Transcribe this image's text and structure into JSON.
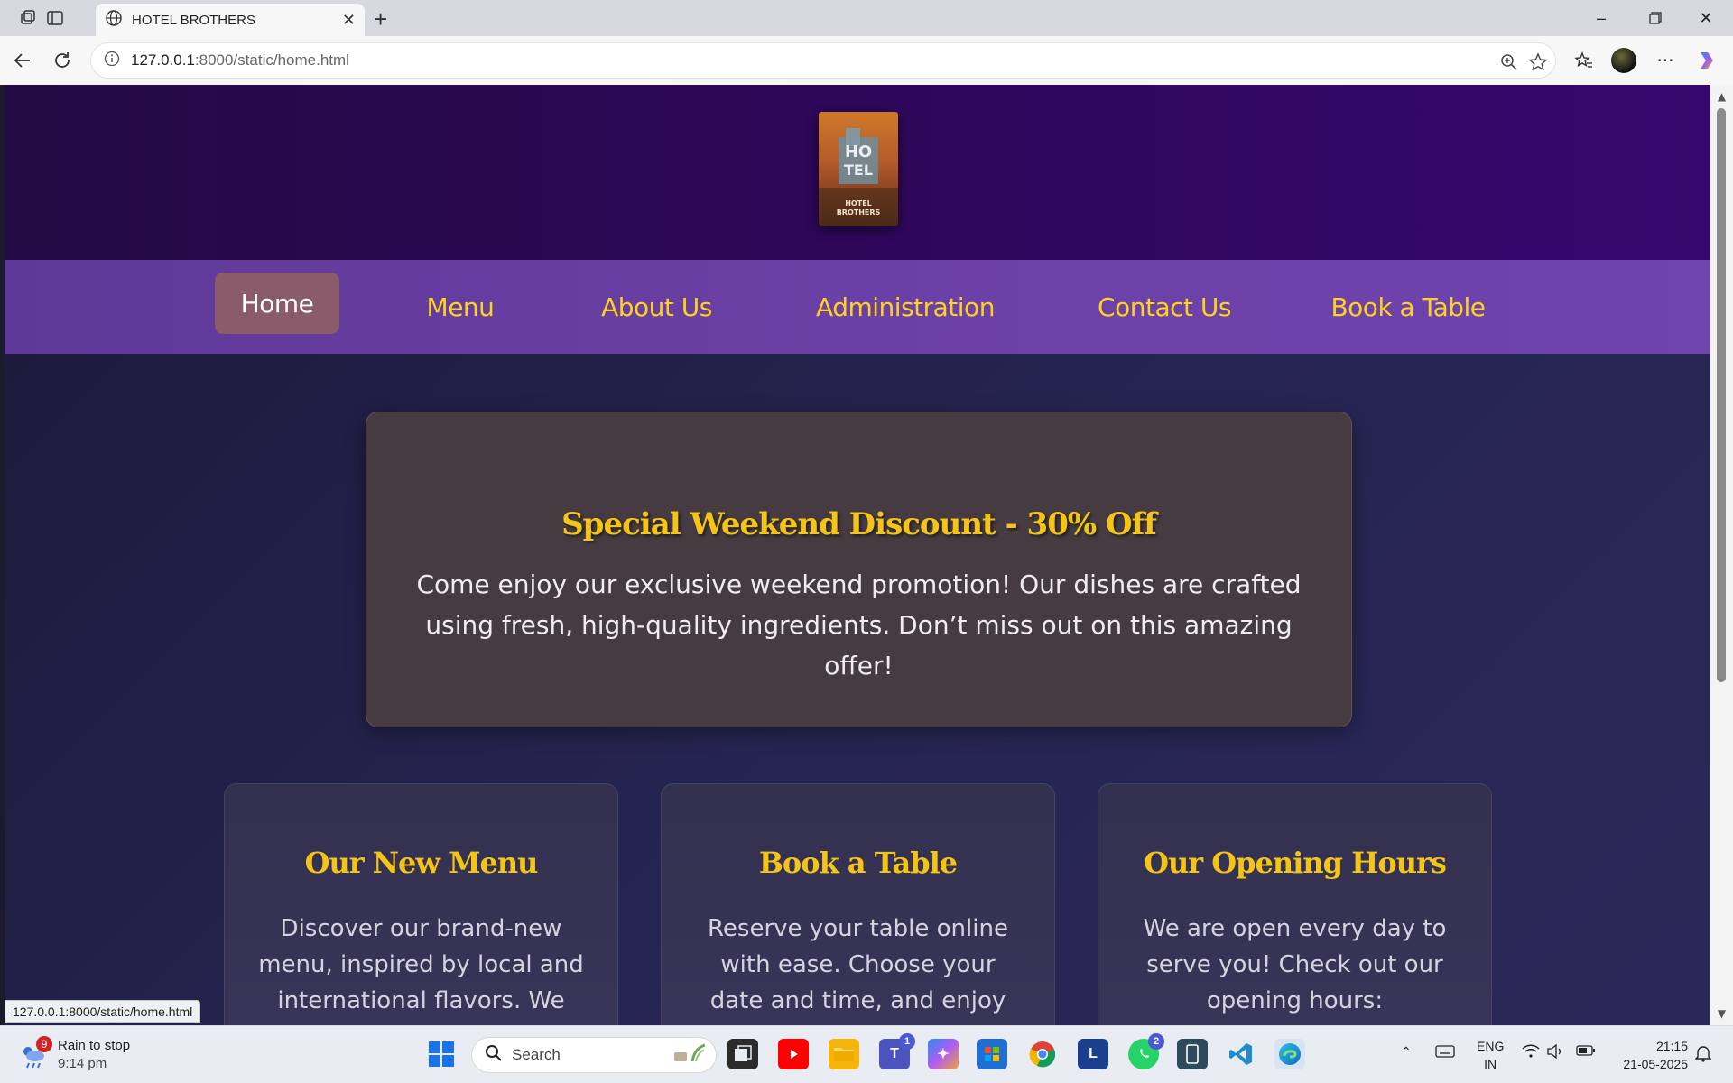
{
  "browser": {
    "tab_title": "HOTEL BROTHERS",
    "url_host": "127.0.0.1",
    "url_rest": ":8000/static/home.html",
    "status_url": "127.0.0.1:8000/static/home.html"
  },
  "site": {
    "logo_text": "HOTEL BROTHERS",
    "nav": {
      "home": "Home",
      "menu": "Menu",
      "about": "About Us",
      "admin": "Administration",
      "contact": "Contact Us",
      "book": "Book a Table"
    },
    "promo": {
      "title": "Special Weekend Discount - 30% Off",
      "text": "Come enjoy our exclusive weekend promotion! Our dishes are crafted using fresh, high-quality ingredients. Don’t miss out on this amazing offer!"
    },
    "cards": [
      {
        "title": "Our New Menu",
        "text": "Discover our brand-new menu, inspired by local and international flavors. We have"
      },
      {
        "title": "Book a Table",
        "text": "Reserve your table online with ease. Choose your date and time, and enjoy an"
      },
      {
        "title": "Our Opening Hours",
        "text": "We are open every day to serve you! Check out our opening hours:"
      }
    ],
    "colors": {
      "accent": "#ffd21f",
      "nav_bg": "#6b40a6",
      "header_bg": "#2e0759",
      "active_nav": "#8a5b6b"
    }
  },
  "taskbar": {
    "weather_title": "Rain to stop",
    "weather_time": "9:14 pm",
    "weather_badge": "9",
    "search_label": "Search",
    "teams_badge": "1",
    "whatsapp_badge": "2",
    "lang_1": "ENG",
    "lang_2": "IN",
    "time": "21:15",
    "date": "21-05-2025"
  }
}
